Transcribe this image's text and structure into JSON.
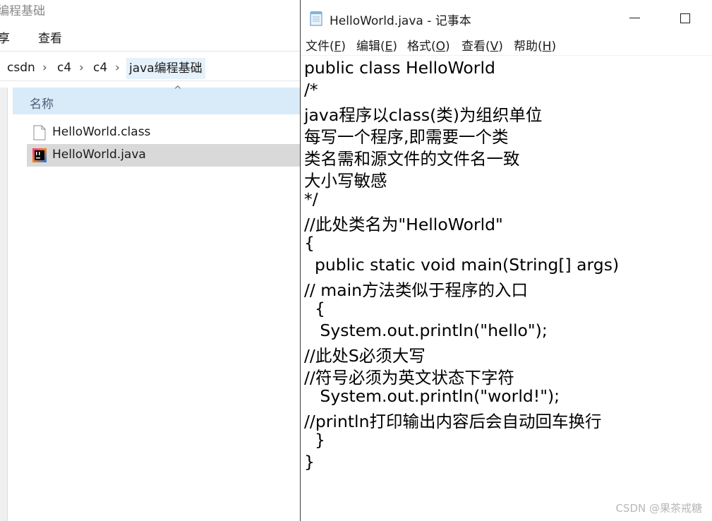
{
  "explorer": {
    "title": "编程基础",
    "ribbon": [
      "享",
      "查看"
    ],
    "breadcrumb": [
      "csdn",
      "c4",
      "c4",
      "java编程基础"
    ],
    "column_name": "名称",
    "files": [
      {
        "name": "HelloWorld.class",
        "icon": "generic-file-icon",
        "selected": false
      },
      {
        "name": "HelloWorld.java",
        "icon": "intellij-java-icon",
        "selected": true
      }
    ]
  },
  "notepad": {
    "title": "HelloWorld.java - 记事本",
    "menu": [
      {
        "label": "文件(",
        "key": "F",
        "tail": ")"
      },
      {
        "label": "编辑(",
        "key": "E",
        "tail": ")"
      },
      {
        "label": "格式(",
        "key": "O",
        "tail": ")"
      },
      {
        "label": "查看(",
        "key": "V",
        "tail": ")"
      },
      {
        "label": "帮助(",
        "key": "H",
        "tail": ")"
      }
    ],
    "lines": [
      "public class HelloWorld",
      "/*",
      "java程序以class(类)为组织单位",
      "每写一个程序,即需要一个类",
      "类名需和源文件的文件名一致",
      "大小写敏感",
      "*/",
      "//此处类名为\"HelloWorld\"",
      "{",
      "  public static void main(String[] args)",
      "// main方法类似于程序的入口",
      "  {",
      "   System.out.println(\"hello\");",
      "//此处S必须大写",
      "//符号必须为英文状态下字符",
      "   System.out.println(\"world!\");",
      "//println打印输出内容后会自动回车换行",
      "  }",
      "}"
    ]
  },
  "watermark": "CSDN @果茶戒糖"
}
